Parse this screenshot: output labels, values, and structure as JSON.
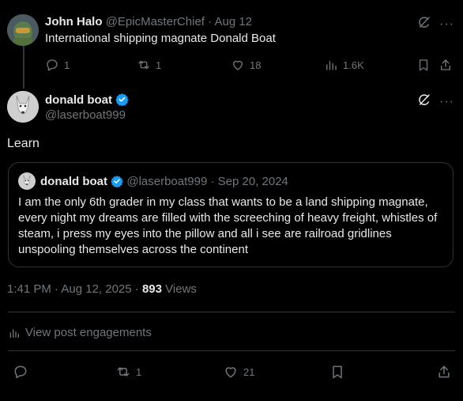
{
  "reply_to": {
    "author_name": "John Halo",
    "handle": "@EpicMasterChief",
    "separator": "·",
    "date": "Aug 12",
    "text": "International shipping magnate Donald Boat",
    "actions": {
      "replies": "1",
      "reposts": "1",
      "likes": "18",
      "views": "1.6K"
    }
  },
  "main_post": {
    "author_name": "donald boat",
    "handle": "@laserboat999",
    "text": "Learn",
    "timestamp": "1:41 PM · Aug 12, 2025 ·",
    "views_count": "893",
    "views_label": "Views",
    "engagements_label": "View post engagements",
    "actions": {
      "reposts": "1",
      "likes": "21"
    }
  },
  "quoted_post": {
    "author_name": "donald boat",
    "handle": "@laserboat999",
    "separator": "·",
    "date": "Sep 20, 2024",
    "text": "I am the only 6th grader in my class that wants to be a land shipping magnate, every night my dreams are filled with the screeching of heavy freight, whistles of steam, i press my eyes into the pillow and all i see are railroad gridlines unspooling themselves across the continent"
  },
  "colors": {
    "background": "#000000",
    "text": "#e7e9ea",
    "muted": "#71767b",
    "divider": "#2f3336",
    "verified": "#1d9bf0"
  }
}
